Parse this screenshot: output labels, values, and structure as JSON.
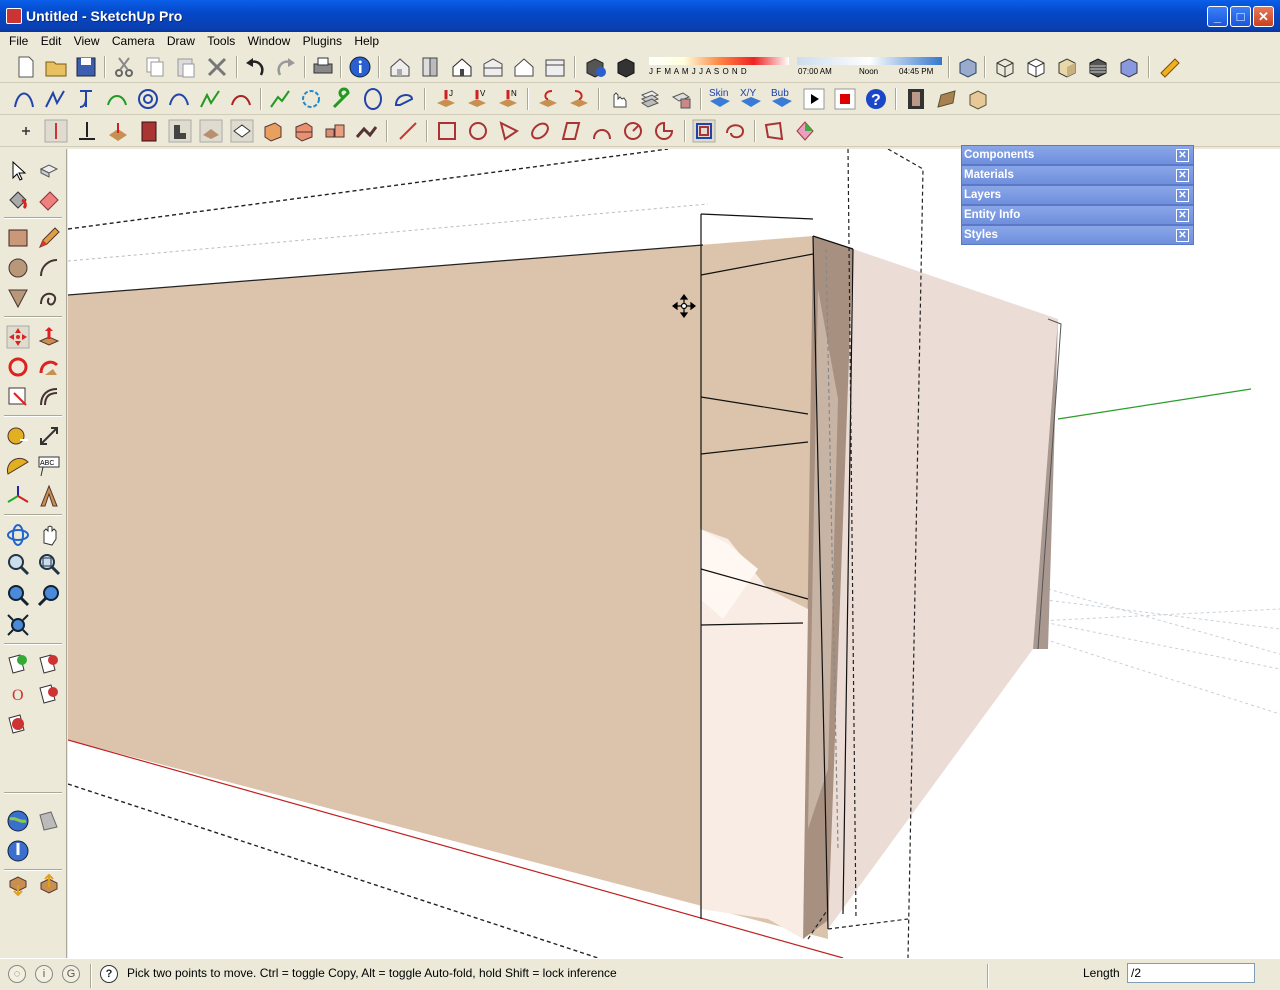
{
  "window": {
    "title": "Untitled - SketchUp Pro",
    "minimize": "_",
    "maximize": "□",
    "close": "✕"
  },
  "menu": [
    "File",
    "Edit",
    "View",
    "Camera",
    "Draw",
    "Tools",
    "Window",
    "Plugins",
    "Help"
  ],
  "shadow_bar": {
    "months": "J F M A M J J A S O N D",
    "time_start": "07:00 AM",
    "time_mid": "Noon",
    "time_end": "04:45 PM"
  },
  "plugin_labels": {
    "skin": "Skin",
    "xyz": "X/Y",
    "bub": "Bub",
    "j": "J",
    "v": "V",
    "n": "N"
  },
  "trays": [
    "Components",
    "Materials",
    "Layers",
    "Entity Info",
    "Styles"
  ],
  "status": {
    "message": "Pick two points to move.  Ctrl = toggle Copy, Alt = toggle Auto-fold, hold Shift = lock inference",
    "length_label": "Length",
    "length_value": "/2"
  },
  "colors": {
    "titlebar": "#0a5fe8",
    "face": "#dcc4ac",
    "tray": "#7894dc",
    "axis_green": "#2a9d2a",
    "axis_red": "#c02020"
  },
  "icons": {
    "toolbar1": [
      "new-icon",
      "open-icon",
      "save-icon",
      "cut-icon",
      "copy-icon",
      "paste-icon",
      "erase-icon",
      "undo-icon",
      "redo-icon",
      "print-icon",
      "model-info-icon",
      "iso-view-icon",
      "top-view-icon",
      "front-view-icon",
      "right-view-icon",
      "back-view-icon",
      "left-view-icon",
      "shadow-settings-icon",
      "shadows-toggle-icon",
      "xray-icon",
      "wireframe-icon",
      "hidden-line-icon",
      "shaded-icon",
      "shaded-textures-icon",
      "monochrome-icon",
      "tape-measure-icon"
    ],
    "left": [
      "select-icon",
      "component-icon",
      "paint-bucket-icon",
      "eraser-icon",
      "rectangle-icon",
      "pencil-icon",
      "circle-icon",
      "arc-icon",
      "polygon-icon",
      "freehand-icon",
      "move-icon",
      "push-pull-icon",
      "rotate-icon",
      "follow-me-icon",
      "scale-icon",
      "offset-icon",
      "tape-measure-icon",
      "dimension-icon",
      "protractor-icon",
      "text-icon",
      "axes-icon",
      "3d-text-icon",
      "orbit-icon",
      "pan-icon",
      "zoom-icon",
      "zoom-window-icon",
      "previous-view-icon",
      "next-view-icon",
      "zoom-extents-icon",
      "add-location-icon",
      "toggle-terrain-icon",
      "preview-google-earth-icon",
      "get-models-icon",
      "share-model-icon"
    ]
  }
}
